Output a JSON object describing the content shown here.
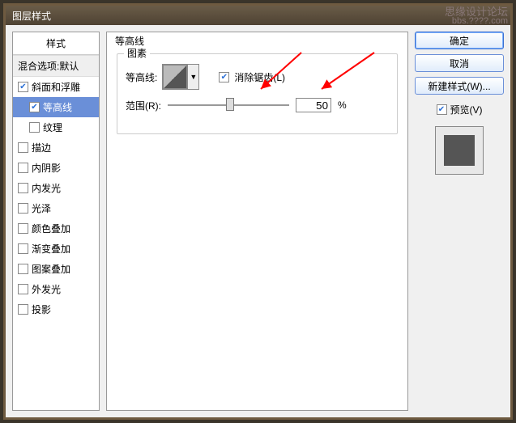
{
  "watermark": {
    "line1": "思缘设计论坛",
    "line2": "bbs.????.com"
  },
  "window": {
    "title": "图层样式"
  },
  "left": {
    "header": "样式",
    "blend_row": "混合选项:默认",
    "items": [
      {
        "label": "斜面和浮雕",
        "checked": true
      },
      {
        "label": "等高线",
        "checked": true,
        "sub": true,
        "selected": true
      },
      {
        "label": "纹理",
        "checked": false,
        "sub": true
      },
      {
        "label": "描边",
        "checked": false
      },
      {
        "label": "内阴影",
        "checked": false
      },
      {
        "label": "内发光",
        "checked": false
      },
      {
        "label": "光泽",
        "checked": false
      },
      {
        "label": "颜色叠加",
        "checked": false
      },
      {
        "label": "渐变叠加",
        "checked": false
      },
      {
        "label": "图案叠加",
        "checked": false
      },
      {
        "label": "外发光",
        "checked": false
      },
      {
        "label": "投影",
        "checked": false
      }
    ]
  },
  "mid": {
    "title": "等高线",
    "group": "图素",
    "contour_label": "等高线:",
    "anti_alias": "消除锯齿(L)",
    "range_label": "范围(R):",
    "range_value": "50",
    "range_unit": "%"
  },
  "right": {
    "ok": "确定",
    "cancel": "取消",
    "new_style": "新建样式(W)...",
    "preview": "预览(V)"
  }
}
